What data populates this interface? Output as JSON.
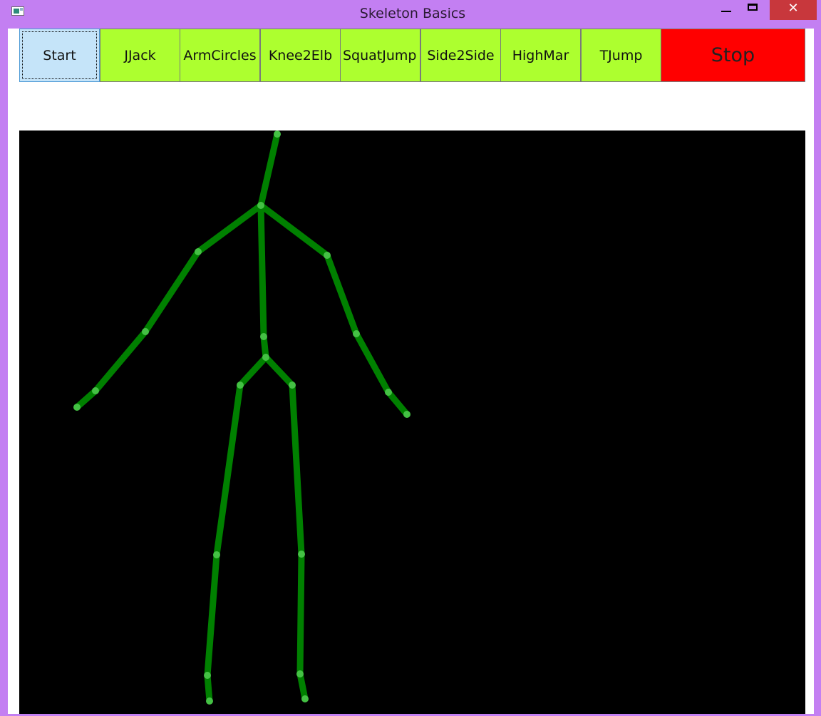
{
  "window": {
    "title": "Skeleton Basics",
    "close_glyph": "✕"
  },
  "toolbar": {
    "buttons": [
      {
        "id": "start",
        "label": "Start"
      },
      {
        "id": "jjack",
        "label": "JJack"
      },
      {
        "id": "armcircles",
        "label": "ArmCircles"
      },
      {
        "id": "knee2elb",
        "label": "Knee2Elb"
      },
      {
        "id": "squatjump",
        "label": "SquatJump"
      },
      {
        "id": "side2side",
        "label": "Side2Side"
      },
      {
        "id": "highmar",
        "label": "HighMar"
      },
      {
        "id": "tjump",
        "label": "TJump"
      },
      {
        "id": "stop",
        "label": "Stop"
      }
    ]
  },
  "skeleton": {
    "bone_color": "#008000",
    "joint_color": "#44c144",
    "background": "#000000"
  }
}
